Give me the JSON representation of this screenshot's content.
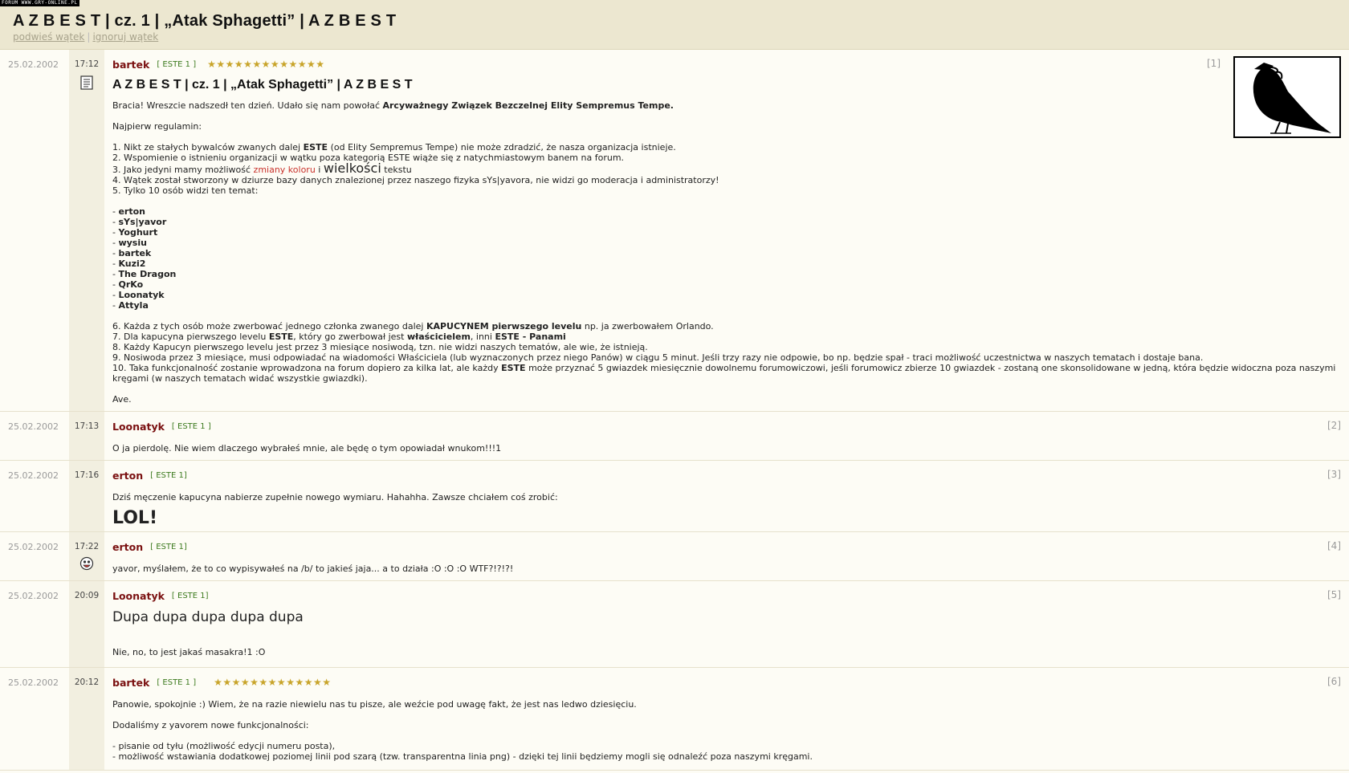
{
  "watermark": "FORUM WWW.GRY-ONLINE.PL",
  "thread": {
    "title": "A Z B E S T | cz. 1 | „Atak Sphagetti” | A Z B E S T",
    "links": [
      "podwieś wątek",
      "ignoruj wątek"
    ]
  },
  "posts": [
    {
      "date": "25.02.2002",
      "time": "17:12",
      "author": "bartek",
      "badge": "[ ESTE 1 ]",
      "stars": "★★★★★★★★★★★★★",
      "num": "[1]",
      "title": "A Z B E S T | cz. 1 | „Atak Sphagetti” | A Z B E S T",
      "intro_a": "Bracia! Wreszcie nadszedł ten dzień. Udało się nam powołać ",
      "intro_b": "Arcyważnegy Związek Bezczelnej Elity Sempremus Tempe.",
      "rules_title": "Najpierw regulamin:",
      "r1a": "1. Nikt ze stałych bywalców zwanych dalej ",
      "r1b": "ESTE",
      "r1c": " (od Elity Sempremus Tempe) nie może zdradzić, że nasza organizacja istnieje.",
      "r2": "2. Wspomienie o istnieniu organizacji w wątku poza kategorią ESTE wiąże się z natychmiastowym banem na forum.",
      "r3a": "3. Jako jedyni mamy możliwość ",
      "r3b": "zmiany koloru",
      "r3c": " i ",
      "r3d": "wielkości",
      "r3e": " tekstu",
      "r4": "4. Wątek został stworzony w dziurze bazy danych znalezionej przez naszego fizyka sYs|yavora, nie widzi go moderacja i administratorzy!",
      "r5": "5. Tylko 10 osób widzi ten temat:",
      "members": [
        "erton",
        "sYs|yavor",
        "Yoghurt",
        "wysiu",
        "bartek",
        "Kuzi2",
        "The Dragon",
        "QrKo",
        "Loonatyk",
        "Attyla"
      ],
      "member_prefix": "- ",
      "r6a": "6. Każda z tych osób może zwerbować jednego członka zwanego dalej ",
      "r6b": "KAPUCYNEM pierwszego levelu",
      "r6c": " np. ja zwerbowałem Orlando.",
      "r7a": "7. Dla kapucyna pierwszego levelu ",
      "r7b": "ESTE",
      "r7c": ", który go zwerbował jest ",
      "r7d": "właścicielem",
      "r7e": ", inni ",
      "r7f": "ESTE - Panami",
      "r8": "8. Każdy Kapucyn pierwszego levelu jest przez 3 miesiące nosiwodą, tzn. nie widzi naszych tematów, ale wie, że istnieją.",
      "r9": "9. Nosiwoda przez 3 miesiące, musi odpowiadać na wiadomości Właściciela (lub wyznaczonych przez niego Panów) w ciągu 5 minut. Jeśli trzy razy nie odpowie, bo np. będzie spał - traci możliwość uczestnictwa w naszych tematach i dostaje bana.",
      "r10a": "10. Taka funkcjonalność zostanie wprowadzona na forum dopiero za kilka lat, ale każdy ",
      "r10b": "ESTE",
      "r10c": " może przyznać 5 gwiazdek miesięcznie dowolnemu forumowiczowi, jeśli forumowicz zbierze 10 gwiazdek - zostaną one skonsolidowane w jedną, która będzie widoczna poza naszymi kręgami (w naszych tematach widać wszystkie gwiazdki).",
      "closing": "Ave."
    },
    {
      "date": "25.02.2002",
      "time": "17:13",
      "author": "Loonatyk",
      "badge": "[ ESTE 1 ]",
      "num": "[2]",
      "text": "O ja pierdolę. Nie wiem dlaczego wybrałeś mnie, ale będę o tym opowiadał wnukom!!!1"
    },
    {
      "date": "25.02.2002",
      "time": "17:16",
      "author": "erton",
      "badge": "[ ESTE 1]",
      "num": "[3]",
      "text": "Dziś męczenie kapucyna nabierze zupełnie nowego wymiaru. Hahahha. Zawsze chciałem coś zrobić:",
      "big": "LOL!"
    },
    {
      "date": "25.02.2002",
      "time": "17:22",
      "author": "erton",
      "badge": "[ ESTE 1]",
      "num": "[4]",
      "text": "yavor, myślałem, że to co wypisywałeś na /b/ to jakieś jaja... a to działa :O :O :O WTF?!?!?!"
    },
    {
      "date": "25.02.2002",
      "time": "20:09",
      "author": "Loonatyk",
      "badge": "[ ESTE 1]",
      "num": "[5]",
      "big": "Dupa dupa dupa dupa dupa",
      "text": "Nie, no, to jest jakaś masakra!1 :O"
    },
    {
      "date": "25.02.2002",
      "time": "20:12",
      "author": "bartek",
      "badge": "[ ESTE 1 ]",
      "stars": "★★★★★★★★★★★★★",
      "num": "[6]",
      "p1": "Panowie, spokojnie :) Wiem, że na razie niewielu nas tu pisze, ale weźcie pod uwagę fakt, że jest nas ledwo dziesięciu.",
      "p2": "Dodaliśmy z yavorem nowe funkcjonalności:",
      "l1": "- pisanie od tyłu (możliwość edycji numeru posta),",
      "l2": "- możliwość wstawiania dodatkowej poziomej linii pod szarą (tzw. transparentna linia png) - dzięki tej linii będziemy mogli się odnaleźć poza naszymi kręgami."
    }
  ]
}
